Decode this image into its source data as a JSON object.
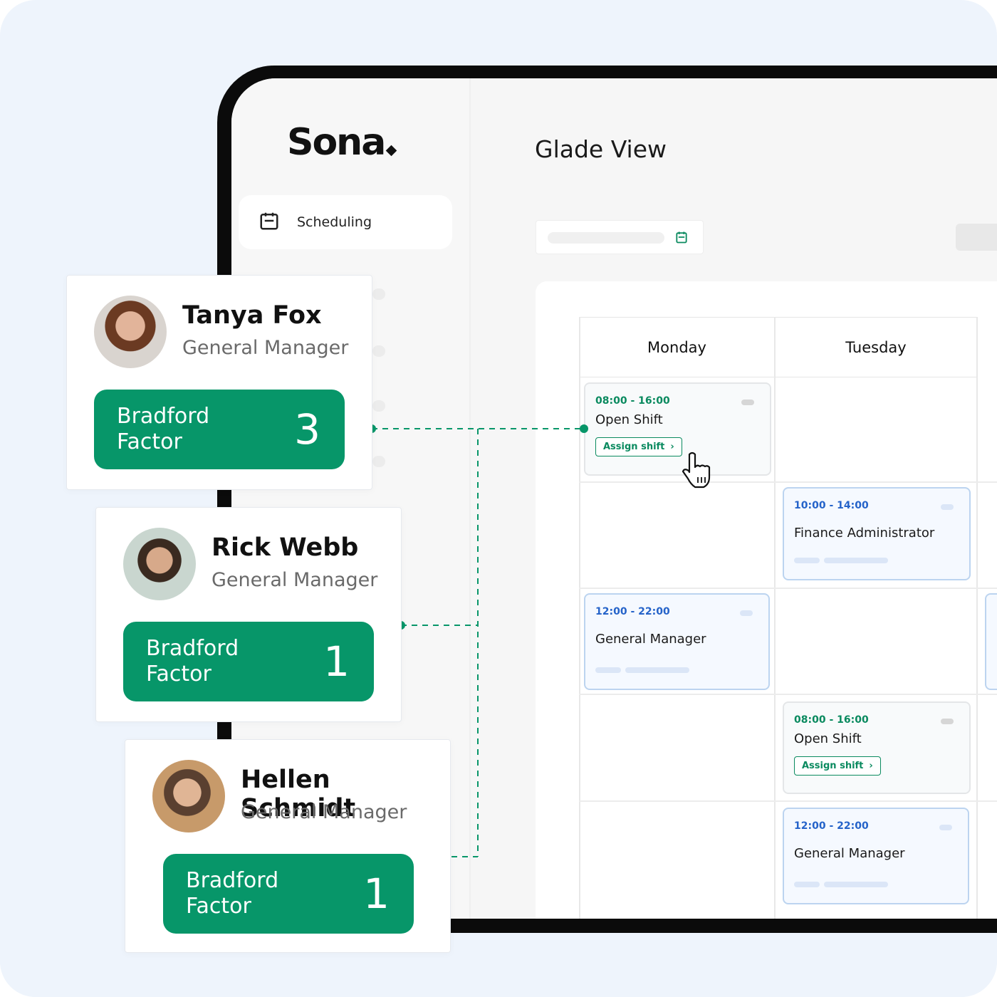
{
  "app": {
    "logo": "Sona",
    "page_title": "Glade View",
    "nav": [
      {
        "label": "Scheduling",
        "icon": "calendar-icon"
      }
    ]
  },
  "calendar": {
    "days": [
      "Monday",
      "Tuesday"
    ],
    "shifts": [
      {
        "day": "Monday",
        "time": "08:00 - 16:00",
        "title": "Open Shift",
        "type": "open",
        "action": "Assign shift"
      },
      {
        "day": "Tuesday",
        "time": "10:00 - 14:00",
        "title": "Finance Administrator",
        "type": "role"
      },
      {
        "day": "Monday",
        "time": "12:00 - 22:00",
        "title": "General Manager",
        "type": "role"
      },
      {
        "day": "Tuesday",
        "time": "08:00 - 16:00",
        "title": "Open Shift",
        "type": "open",
        "action": "Assign shift"
      },
      {
        "day": "Tuesday",
        "time": "12:00 - 22:00",
        "title": "General Manager",
        "type": "role"
      }
    ]
  },
  "employees": [
    {
      "name": "Tanya Fox",
      "role": "General Manager",
      "metric_label": "Bradford Factor",
      "metric_value": "3"
    },
    {
      "name": "Rick Webb",
      "role": "General Manager",
      "metric_label": "Bradford Factor",
      "metric_value": "1"
    },
    {
      "name": "Hellen Schmidt",
      "role": "General Manager",
      "metric_label": "Bradford Factor",
      "metric_value": "1"
    }
  ],
  "colors": {
    "accent_green": "#079669",
    "role_blue": "#2563c9",
    "background": "#eef4fc"
  }
}
